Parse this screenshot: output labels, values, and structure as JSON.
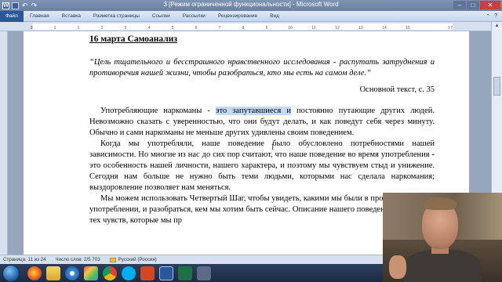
{
  "window": {
    "title": "3 [Режим ограниченной функциональности] - Microsoft Word",
    "min_glyph": "–",
    "max_glyph": "□",
    "close_glyph": "✕"
  },
  "qat": {
    "undo_glyph": "↶",
    "redo_glyph": "↷",
    "app_glyph": "W"
  },
  "ribbon": {
    "tabs": [
      "Файл",
      "Главная",
      "Вставка",
      "Разметка страницы",
      "Ссылки",
      "Рассылки",
      "Рецензирование",
      "Вид"
    ],
    "help_glyph": "?",
    "collapse_glyph": "⌃"
  },
  "ruler": {
    "numbers": [
      "3",
      "1",
      "1",
      "2",
      "3",
      "4",
      "5",
      "6",
      "7",
      "8",
      "9",
      "10",
      "11",
      "12",
      "13",
      "14",
      "15",
      "17"
    ]
  },
  "document": {
    "heading": "16 марта   Самоанализ",
    "quote": "“Цель тщательного и бесстрашного нравственного исследования - распутать затруднения и противоречия нашей жизни, чтобы разобраться, кто мы есть на самом деле.”",
    "source": "Основной текст, с. 35",
    "para1_before": "Употребляющие наркоманы - ",
    "para1_highlight": "это запутавшиеся и",
    "para1_after": " постоянно путающие других людей. Невозможно сказать с уверенностью, что они будут делать, и как поведут себя через минуту. Обычно и сами наркоманы не меньше других удивлены своим поведением.",
    "para2": "Когда мы употребляли, наше поведение было обусловлено потребностями нашей зависимости.  Но многие из нас до сих пор считают, что наше поведение во время употребления - это особенность нашей личности, нашего характера, и поэтому мы чувствуем стыд и унижение. Сегодня нам больше не нужно быть теми людьми, которыми нас сделала наркомания; выздоровление позволяет нам меняться.",
    "para3": "Мы можем использовать Четвертый Шаг, чтобы увидеть, какими мы были в прошлой жизни, в употреблении, и разобраться, кем мы хотим быть сейчас. Описание нашего поведения и особенно тех чувств, которые мы пр"
  },
  "statusbar": {
    "page": "Страница: 11 из 24",
    "words": "Число слов: 2/5 703",
    "language": "Русский (Россия)"
  },
  "taskbar": {
    "tray_lang": "RU",
    "icons": [
      "firefox-icon",
      "folder-icon",
      "media-player-icon",
      "paint-icon",
      "chrome-icon",
      "skype-icon",
      "powerpoint-icon",
      "word-icon",
      "excel-icon",
      "app-icon"
    ]
  },
  "colors": {
    "titlebar": "#6b80a2",
    "selection_highlight": "#c3d9f5",
    "word_blue": "#2b579a",
    "taskbar": "#1d2b44"
  }
}
